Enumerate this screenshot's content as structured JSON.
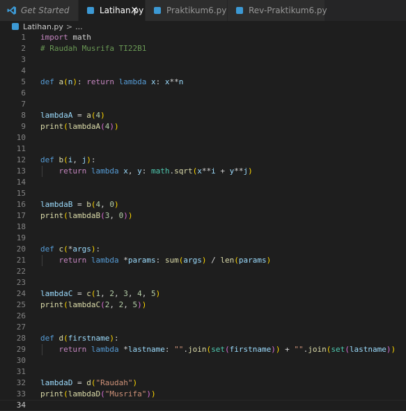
{
  "tabs": [
    {
      "label": "Get Started",
      "icon": "vscode-icon",
      "italic": true,
      "active": false
    },
    {
      "label": "Latihan.py",
      "icon": "python-file-icon",
      "italic": false,
      "active": true,
      "close_glyph": "×"
    },
    {
      "label": "Praktikum6.py",
      "icon": "python-file-icon",
      "italic": false,
      "active": false
    },
    {
      "label": "Rev-Praktikum6.py",
      "icon": "python-file-icon",
      "italic": false,
      "active": false
    }
  ],
  "breadcrumb": {
    "file": "Latihan.py",
    "separator": ">",
    "more": "..."
  },
  "editor": {
    "current_line": 34,
    "lines": [
      {
        "n": "1",
        "tokens": [
          [
            "import",
            "k"
          ],
          [
            " math",
            "o"
          ]
        ]
      },
      {
        "n": "2",
        "tokens": [
          [
            "# Raudah Musrifa TI22B1",
            "c"
          ]
        ]
      },
      {
        "n": "3",
        "tokens": []
      },
      {
        "n": "4",
        "tokens": []
      },
      {
        "n": "5",
        "tokens": [
          [
            "def",
            "d"
          ],
          [
            " ",
            "o"
          ],
          [
            "a",
            "f"
          ],
          [
            "(",
            "b1"
          ],
          [
            "n",
            "v"
          ],
          [
            ")",
            "b1"
          ],
          [
            ": ",
            "o"
          ],
          [
            "return",
            "k"
          ],
          [
            " ",
            "o"
          ],
          [
            "lambda",
            "d"
          ],
          [
            " ",
            "o"
          ],
          [
            "x",
            "v"
          ],
          [
            ": ",
            "o"
          ],
          [
            "x",
            "v"
          ],
          [
            "**",
            "o"
          ],
          [
            "n",
            "v"
          ]
        ]
      },
      {
        "n": "6",
        "tokens": []
      },
      {
        "n": "7",
        "tokens": []
      },
      {
        "n": "8",
        "tokens": [
          [
            "lambdaA",
            "v"
          ],
          [
            " = ",
            "o"
          ],
          [
            "a",
            "f"
          ],
          [
            "(",
            "b1"
          ],
          [
            "4",
            "n"
          ],
          [
            ")",
            "b1"
          ]
        ]
      },
      {
        "n": "9",
        "tokens": [
          [
            "print",
            "f"
          ],
          [
            "(",
            "b1"
          ],
          [
            "lambdaA",
            "f"
          ],
          [
            "(",
            "b2"
          ],
          [
            "4",
            "n"
          ],
          [
            ")",
            "b2"
          ],
          [
            ")",
            "b1"
          ]
        ]
      },
      {
        "n": "10",
        "tokens": []
      },
      {
        "n": "11",
        "tokens": []
      },
      {
        "n": "12",
        "tokens": [
          [
            "def",
            "d"
          ],
          [
            " ",
            "o"
          ],
          [
            "b",
            "f"
          ],
          [
            "(",
            "b1"
          ],
          [
            "i",
            "v"
          ],
          [
            ", ",
            "o"
          ],
          [
            "j",
            "v"
          ],
          [
            ")",
            "b1"
          ],
          [
            ":",
            "o"
          ]
        ]
      },
      {
        "n": "13",
        "indent": true,
        "tokens": [
          [
            "    ",
            "o"
          ],
          [
            "return",
            "k"
          ],
          [
            " ",
            "o"
          ],
          [
            "lambda",
            "d"
          ],
          [
            " ",
            "o"
          ],
          [
            "x",
            "v"
          ],
          [
            ", ",
            "o"
          ],
          [
            "y",
            "v"
          ],
          [
            ": ",
            "o"
          ],
          [
            "math",
            "t"
          ],
          [
            ".",
            "o"
          ],
          [
            "sqrt",
            "f"
          ],
          [
            "(",
            "b1"
          ],
          [
            "x",
            "v"
          ],
          [
            "**",
            "o"
          ],
          [
            "i",
            "v"
          ],
          [
            " + ",
            "o"
          ],
          [
            "y",
            "v"
          ],
          [
            "**",
            "o"
          ],
          [
            "j",
            "v"
          ],
          [
            ")",
            "b1"
          ]
        ]
      },
      {
        "n": "14",
        "tokens": []
      },
      {
        "n": "15",
        "tokens": []
      },
      {
        "n": "16",
        "tokens": [
          [
            "lambdaB",
            "v"
          ],
          [
            " = ",
            "o"
          ],
          [
            "b",
            "f"
          ],
          [
            "(",
            "b1"
          ],
          [
            "4",
            "n"
          ],
          [
            ", ",
            "o"
          ],
          [
            "0",
            "n"
          ],
          [
            ")",
            "b1"
          ]
        ]
      },
      {
        "n": "17",
        "tokens": [
          [
            "print",
            "f"
          ],
          [
            "(",
            "b1"
          ],
          [
            "lambdaB",
            "f"
          ],
          [
            "(",
            "b2"
          ],
          [
            "3",
            "n"
          ],
          [
            ", ",
            "o"
          ],
          [
            "0",
            "n"
          ],
          [
            ")",
            "b2"
          ],
          [
            ")",
            "b1"
          ]
        ]
      },
      {
        "n": "18",
        "tokens": []
      },
      {
        "n": "19",
        "tokens": []
      },
      {
        "n": "20",
        "tokens": [
          [
            "def",
            "d"
          ],
          [
            " ",
            "o"
          ],
          [
            "c",
            "f"
          ],
          [
            "(",
            "b1"
          ],
          [
            "*",
            "o"
          ],
          [
            "args",
            "v"
          ],
          [
            ")",
            "b1"
          ],
          [
            ":",
            "o"
          ]
        ]
      },
      {
        "n": "21",
        "indent": true,
        "tokens": [
          [
            "    ",
            "o"
          ],
          [
            "return",
            "k"
          ],
          [
            " ",
            "o"
          ],
          [
            "lambda",
            "d"
          ],
          [
            " *",
            "o"
          ],
          [
            "params",
            "v"
          ],
          [
            ": ",
            "o"
          ],
          [
            "sum",
            "f"
          ],
          [
            "(",
            "b1"
          ],
          [
            "args",
            "v"
          ],
          [
            ")",
            "b1"
          ],
          [
            " / ",
            "o"
          ],
          [
            "len",
            "f"
          ],
          [
            "(",
            "b1"
          ],
          [
            "params",
            "v"
          ],
          [
            ")",
            "b1"
          ]
        ]
      },
      {
        "n": "22",
        "tokens": []
      },
      {
        "n": "23",
        "tokens": []
      },
      {
        "n": "24",
        "tokens": [
          [
            "lambdaC",
            "v"
          ],
          [
            " = ",
            "o"
          ],
          [
            "c",
            "f"
          ],
          [
            "(",
            "b1"
          ],
          [
            "1",
            "n"
          ],
          [
            ", ",
            "o"
          ],
          [
            "2",
            "n"
          ],
          [
            ", ",
            "o"
          ],
          [
            "3",
            "n"
          ],
          [
            ", ",
            "o"
          ],
          [
            "4",
            "n"
          ],
          [
            ", ",
            "o"
          ],
          [
            "5",
            "n"
          ],
          [
            ")",
            "b1"
          ]
        ]
      },
      {
        "n": "25",
        "tokens": [
          [
            "print",
            "f"
          ],
          [
            "(",
            "b1"
          ],
          [
            "lambdaC",
            "f"
          ],
          [
            "(",
            "b2"
          ],
          [
            "2",
            "n"
          ],
          [
            ", ",
            "o"
          ],
          [
            "2",
            "n"
          ],
          [
            ", ",
            "o"
          ],
          [
            "5",
            "n"
          ],
          [
            ")",
            "b2"
          ],
          [
            ")",
            "b1"
          ]
        ]
      },
      {
        "n": "26",
        "tokens": []
      },
      {
        "n": "27",
        "tokens": []
      },
      {
        "n": "28",
        "tokens": [
          [
            "def",
            "d"
          ],
          [
            " ",
            "o"
          ],
          [
            "d",
            "f"
          ],
          [
            "(",
            "b1"
          ],
          [
            "firstname",
            "v"
          ],
          [
            ")",
            "b1"
          ],
          [
            ":",
            "o"
          ]
        ]
      },
      {
        "n": "29",
        "indent": true,
        "tokens": [
          [
            "    ",
            "o"
          ],
          [
            "return",
            "k"
          ],
          [
            " ",
            "o"
          ],
          [
            "lambda",
            "d"
          ],
          [
            " *",
            "o"
          ],
          [
            "lastname",
            "v"
          ],
          [
            ": ",
            "o"
          ],
          [
            "\"\"",
            "s"
          ],
          [
            ".",
            "o"
          ],
          [
            "join",
            "f"
          ],
          [
            "(",
            "b1"
          ],
          [
            "set",
            "t"
          ],
          [
            "(",
            "b2"
          ],
          [
            "firstname",
            "v"
          ],
          [
            ")",
            "b2"
          ],
          [
            ")",
            "b1"
          ],
          [
            " + ",
            "o"
          ],
          [
            "\"\"",
            "s"
          ],
          [
            ".",
            "o"
          ],
          [
            "join",
            "f"
          ],
          [
            "(",
            "b1"
          ],
          [
            "set",
            "t"
          ],
          [
            "(",
            "b2"
          ],
          [
            "lastname",
            "v"
          ],
          [
            ")",
            "b2"
          ],
          [
            ")",
            "b1"
          ]
        ]
      },
      {
        "n": "30",
        "tokens": []
      },
      {
        "n": "31",
        "tokens": []
      },
      {
        "n": "32",
        "tokens": [
          [
            "lambdaD",
            "v"
          ],
          [
            " = ",
            "o"
          ],
          [
            "d",
            "f"
          ],
          [
            "(",
            "b1"
          ],
          [
            "\"Raudah\"",
            "s"
          ],
          [
            ")",
            "b1"
          ]
        ]
      },
      {
        "n": "33",
        "tokens": [
          [
            "print",
            "f"
          ],
          [
            "(",
            "b1"
          ],
          [
            "lambdaD",
            "f"
          ],
          [
            "(",
            "b2"
          ],
          [
            "\"Musrifa\"",
            "s"
          ],
          [
            ")",
            "b2"
          ],
          [
            ")",
            "b1"
          ]
        ]
      },
      {
        "n": "34",
        "tokens": []
      }
    ]
  },
  "colors": {
    "background": "#1e1e1e",
    "tabbar": "#252526",
    "keyword_control": "#c586c0",
    "keyword_def": "#569cd6",
    "function": "#dcdcaa",
    "variable": "#9cdcfe",
    "number": "#b5cea8",
    "string": "#ce9178",
    "comment": "#6a9955"
  }
}
